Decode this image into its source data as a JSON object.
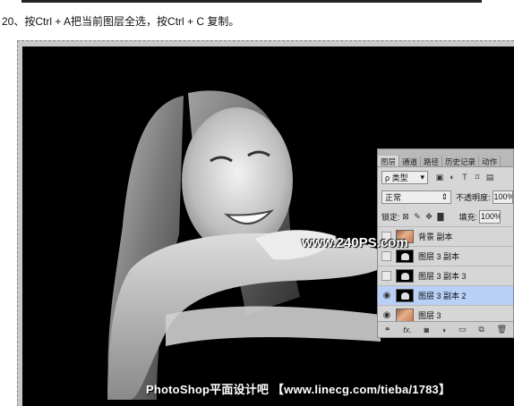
{
  "instruction": {
    "text": "20、按Ctrl + A把当前图层全选，按Ctrl + C 复制。"
  },
  "watermarks": {
    "site": "www.240PS.com",
    "bottom": "PhotoShop平面设计吧 【www.linecg.com/tieba/1783】"
  },
  "layers_panel": {
    "tabs": [
      "图层",
      "通道",
      "路径",
      "历史记录",
      "动作"
    ],
    "filter_kind": "ρ 类型",
    "blend_mode": "正常",
    "opacity_label": "不透明度:",
    "opacity_value": "100%",
    "lock_label": "锁定:",
    "fill_label": "填充:",
    "fill_value": "100%",
    "layers": [
      {
        "name": "背景 副本",
        "visible": false,
        "thumb": "photo",
        "selected": false
      },
      {
        "name": "图层 3 副本",
        "visible": false,
        "thumb": "dark",
        "selected": false
      },
      {
        "name": "图层 3 副本 3",
        "visible": false,
        "thumb": "dark",
        "selected": false
      },
      {
        "name": "图层 3 副本 2",
        "visible": true,
        "thumb": "dark",
        "selected": true
      },
      {
        "name": "图层 3",
        "visible": true,
        "thumb": "photo",
        "selected": false
      }
    ],
    "footer_icons": [
      "link-icon",
      "fx-icon",
      "mask-icon",
      "adjustment-icon",
      "folder-icon",
      "new-layer-icon",
      "trash-icon"
    ]
  },
  "colors": {
    "canvas_bg": "#000000",
    "selected_layer": "#b8d0f5",
    "panel_bg": "#d6d6d6"
  }
}
